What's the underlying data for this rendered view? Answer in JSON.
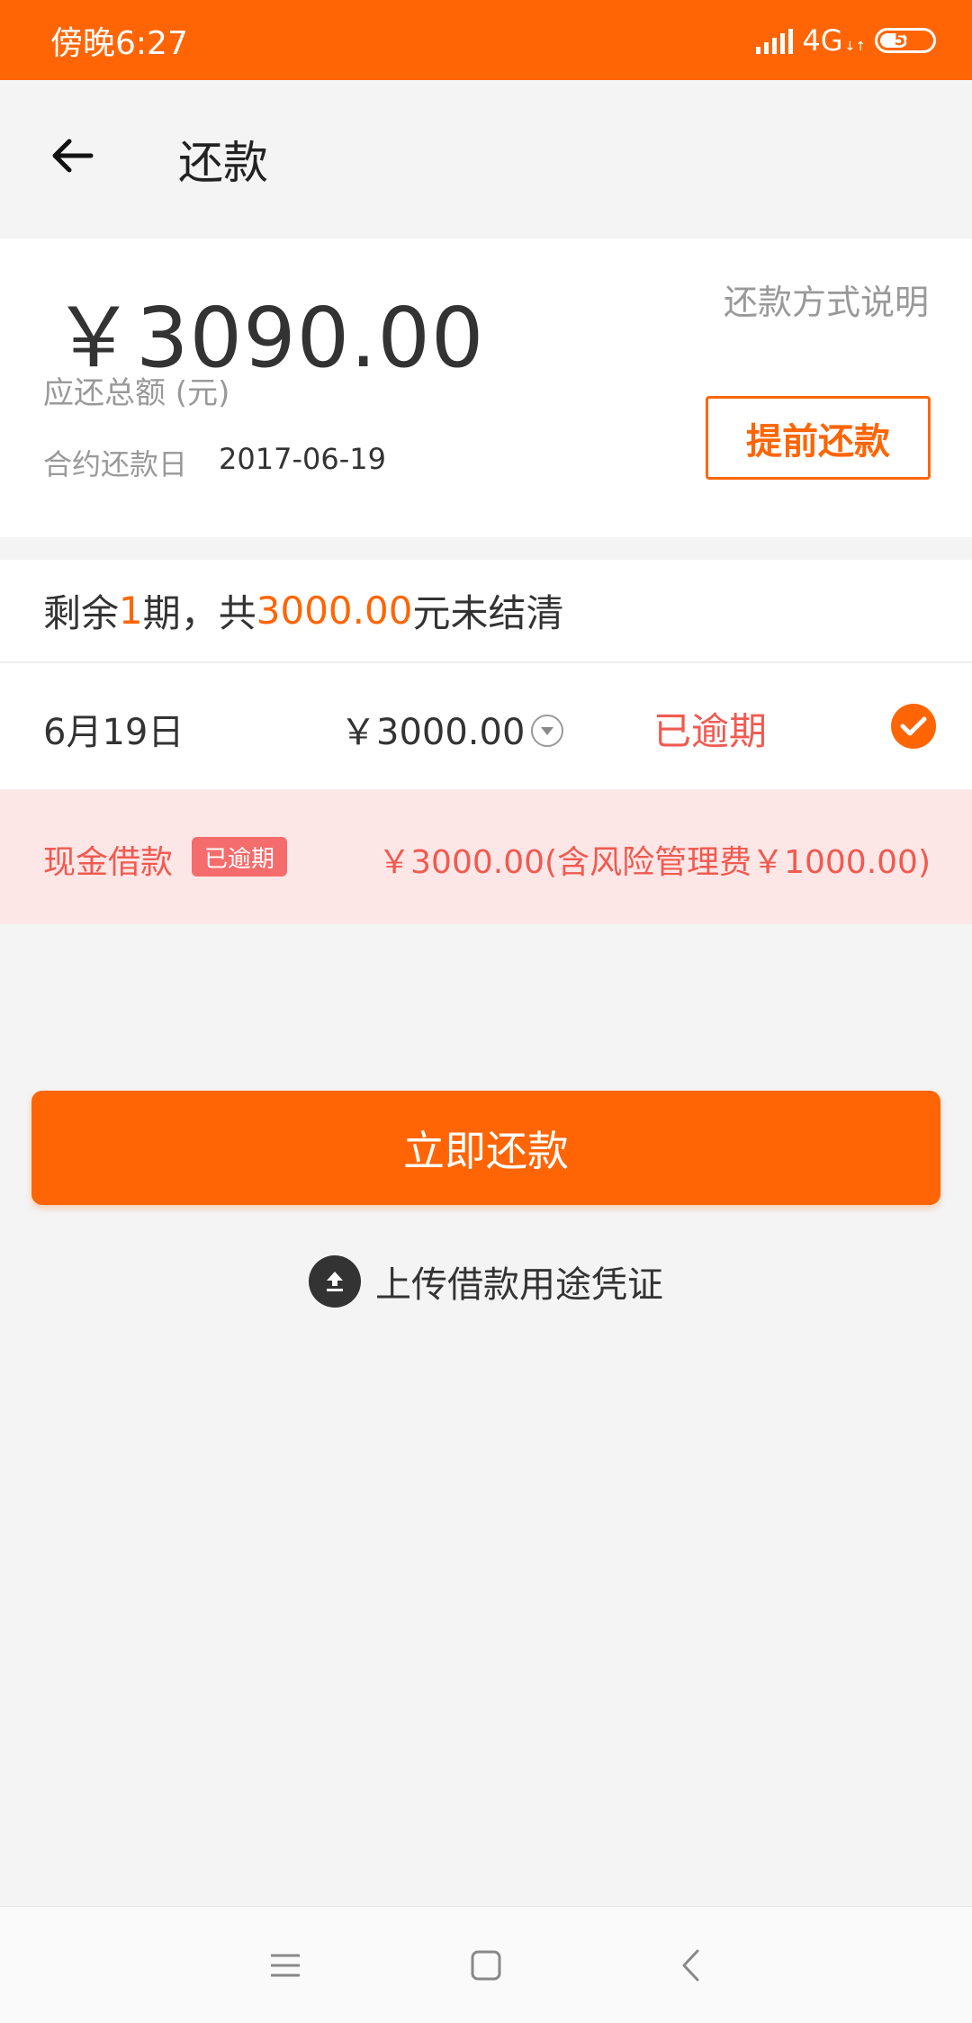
{
  "status_bar": {
    "time": "傍晚6:27",
    "network": "4G",
    "battery": "54",
    "battery_level": 0.54
  },
  "header": {
    "title": "还款"
  },
  "summary": {
    "amount": "￥3090.00",
    "amount_label": "应还总额 (元)",
    "due_label": "合约还款日",
    "due_date": "2017-06-19",
    "method_link": "还款方式说明",
    "prepay_button": "提前还款"
  },
  "remaining": {
    "prefix": "剩余",
    "periods": "1",
    "mid": "期，共",
    "amount": "3000.00",
    "suffix": "元未结清"
  },
  "installment": {
    "date": "6月19日",
    "amount": "￥3000.00",
    "status": "已逾期"
  },
  "loan": {
    "type": "现金借款",
    "badge": "已逾期",
    "amount": "￥3000.00(含风险管理费￥1000.00)"
  },
  "actions": {
    "pay_button": "立即还款",
    "upload_text": "上传借款用途凭证"
  },
  "colors": {
    "brand": "#ff6505",
    "overdue": "#f05a50",
    "overdue_bg": "#fde6e6"
  }
}
